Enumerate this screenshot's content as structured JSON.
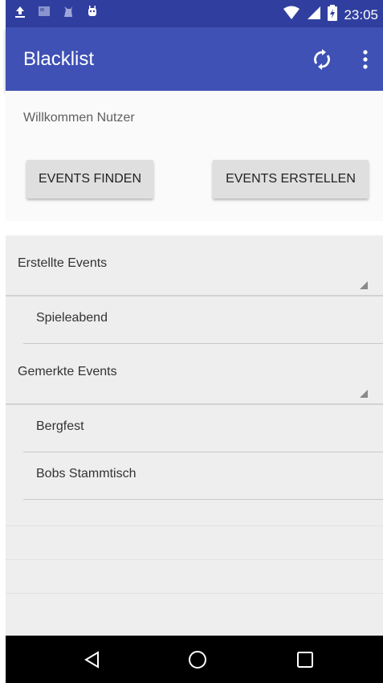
{
  "status_bar": {
    "time": "23:05",
    "left_icons": [
      "upload-icon",
      "image-icon",
      "cat-icon",
      "android-icon"
    ],
    "right_icons": [
      "wifi-icon",
      "signal-icon",
      "battery-charging-icon"
    ]
  },
  "app_bar": {
    "title": "Blacklist",
    "actions": [
      "sync-icon",
      "more-vert-icon"
    ],
    "color": "#3F51B5",
    "status_color": "#303F9F"
  },
  "main": {
    "welcome": "Willkommen Nutzer",
    "find_events_label": "EVENTS FINDEN",
    "create_events_label": "EVENTS ERSTELLEN"
  },
  "groups": [
    {
      "title": "Erstellte Events",
      "items": [
        "Spieleabend"
      ]
    },
    {
      "title": "Gemerkte Events",
      "items": [
        "Bergfest",
        "Bobs Stammtisch"
      ]
    }
  ],
  "nav_bar": {
    "buttons": [
      "back-icon",
      "home-icon",
      "recents-icon"
    ]
  }
}
